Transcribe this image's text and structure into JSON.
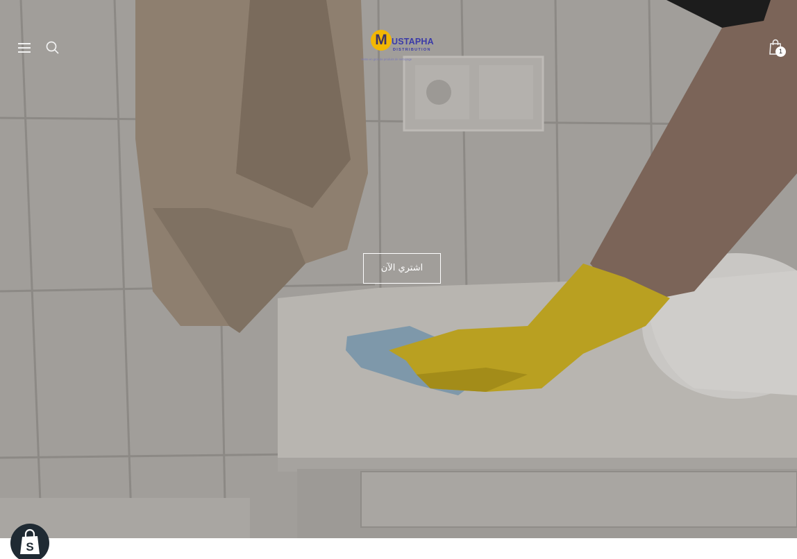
{
  "header": {
    "logo": {
      "initial": "M",
      "name": "USTAPHA",
      "subtitle": "DISTRIBUTION",
      "tagline": "Vente en gros de produits de nettoyage"
    },
    "cart": {
      "count": "1"
    }
  },
  "hero": {
    "cta_label": "اشتري الآن"
  },
  "icons": {
    "menu": "hamburger-menu-icon",
    "search": "search-icon",
    "cart": "shopping-bag-icon",
    "shopify": "shopify-bag-icon"
  },
  "colors": {
    "logo_yellow": "#f2b705",
    "logo_blue": "#3a3aa8",
    "glove_yellow": "#d8b81a",
    "cloth_blue": "#8fb0c6"
  }
}
